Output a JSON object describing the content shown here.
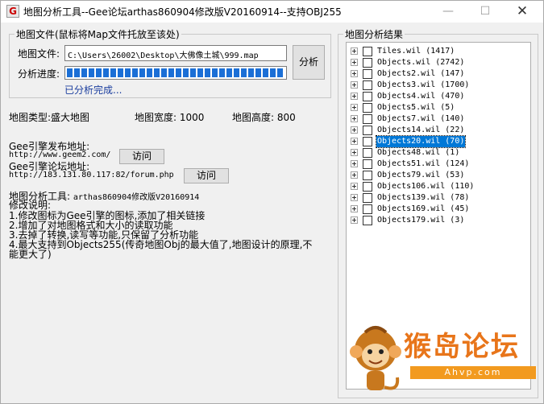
{
  "window": {
    "app_icon": "G",
    "title": "地图分析工具--Gee论坛arthas860904修改版V20160914--支持OBJ255",
    "minimize": "—",
    "maximize": "☐",
    "close": "✕"
  },
  "file_group": {
    "label": "地图文件(鼠标将Map文件托放至该处)",
    "file_label": "地图文件:",
    "file_value": "C:\\Users\\26002\\Desktop\\大佛像土城\\999.map",
    "progress_label": "分析进度:",
    "progress_value": 1.0,
    "status": "已分析完成...",
    "analyze_button": "分析"
  },
  "map_info": {
    "type_label": "地图类型:",
    "type_value": "盛大地图",
    "width_label": "地图宽度:",
    "width_value": "1000",
    "height_label": "地图高度:",
    "height_value": "800"
  },
  "links": {
    "release_label": "Gee引擎发布地址:",
    "release_url": "http://www.geem2.com/",
    "release_button": "访问",
    "forum_label": "Gee引擎论坛地址:",
    "forum_url": "http://183.131.80.117:82/forum.php",
    "forum_button": "访问"
  },
  "notes": {
    "tool_label": "地图分析工具:",
    "tool_value": "arthas860904修改版V20160914",
    "header": "修改说明:",
    "lines": [
      "1.修改图标为Gee引擎的图标,添加了相关链接",
      "2.增加了对地图格式和大小的读取功能",
      "3.去掉了转换,读写等功能,只保留了分析功能",
      "4.最大支持到Objects255(传奇地图Obj的最大值了,地图设计的原理,不",
      "能更大了)"
    ]
  },
  "result_group": {
    "label": "地图分析结果",
    "items": [
      {
        "text": "Tiles.wil (1417)",
        "selected": false
      },
      {
        "text": "Objects.wil (2742)",
        "selected": false
      },
      {
        "text": "Objects2.wil (147)",
        "selected": false
      },
      {
        "text": "Objects3.wil (1700)",
        "selected": false
      },
      {
        "text": "Objects4.wil (470)",
        "selected": false
      },
      {
        "text": "Objects5.wil (5)",
        "selected": false
      },
      {
        "text": "Objects7.wil (140)",
        "selected": false
      },
      {
        "text": "Objects14.wil (22)",
        "selected": false
      },
      {
        "text": "Objects20.wil (70)",
        "selected": true
      },
      {
        "text": "Objects48.wil (1)",
        "selected": false
      },
      {
        "text": "Objects51.wil (124)",
        "selected": false
      },
      {
        "text": "Objects79.wil (53)",
        "selected": false
      },
      {
        "text": "Objects106.wil (110)",
        "selected": false
      },
      {
        "text": "Objects139.wil (78)",
        "selected": false
      },
      {
        "text": "Objects169.wil (45)",
        "selected": false
      },
      {
        "text": "Objects179.wil (3)",
        "selected": false
      }
    ]
  },
  "watermark": {
    "text": "猴岛论坛",
    "url": "Ahvp.com"
  },
  "colors": {
    "progress": "#1b6fd6",
    "selection": "#0078d7",
    "status_text": "#1a3d9e",
    "watermark": "#e8751a"
  }
}
